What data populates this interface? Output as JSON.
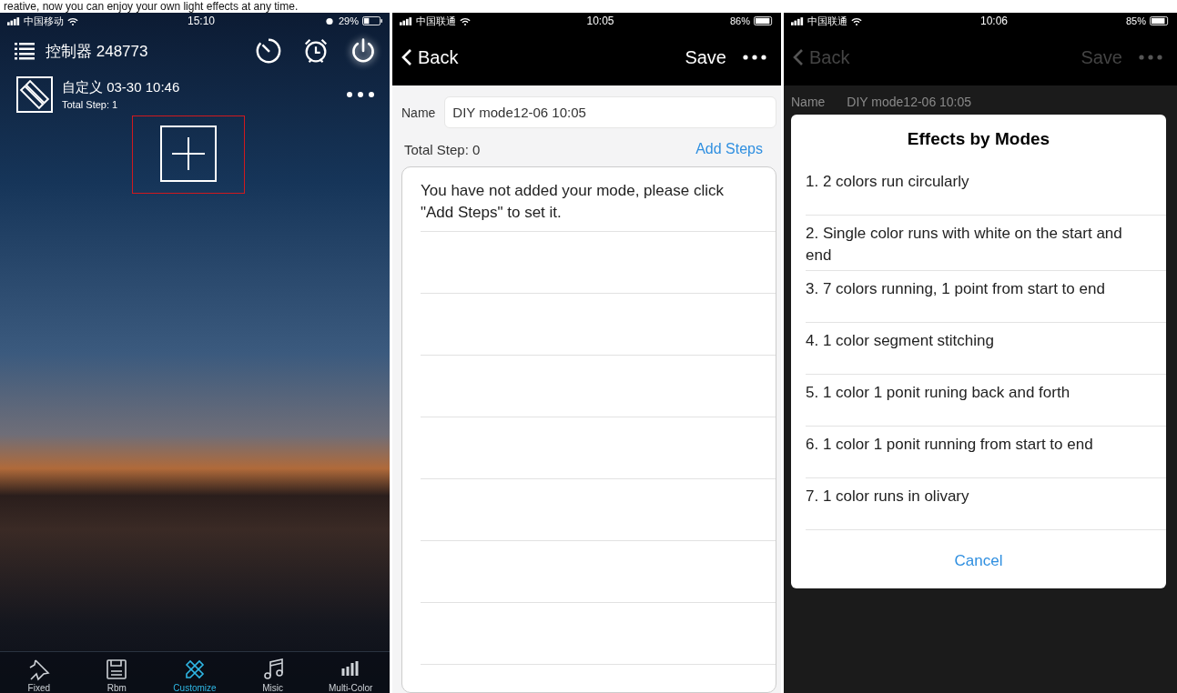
{
  "caption": "reative, now you can enjoy your own light effects at any time.",
  "controller_screen": {
    "status_bar": {
      "carrier": "中国移动",
      "time": "15:10",
      "battery": "29%"
    },
    "title": "控制器 248773",
    "mode": {
      "name": "自定义 03-30 10:46",
      "subtitle": "Total Step: 1"
    },
    "tabs": [
      {
        "label": "Fixed",
        "kind": "pin",
        "selected": false
      },
      {
        "label": "Rbm",
        "kind": "save",
        "selected": false
      },
      {
        "label": "Customize",
        "kind": "tools",
        "selected": true
      },
      {
        "label": "Misic",
        "kind": "music",
        "selected": false
      },
      {
        "label": "Multi-Color",
        "kind": "bars",
        "selected": false
      }
    ]
  },
  "edit_screen": {
    "status_bar": {
      "carrier": "中国联通",
      "time": "10:05",
      "battery": "86%"
    },
    "back": "Back",
    "save": "Save",
    "name_label": "Name",
    "name_value": "DIY mode12-06 10:05",
    "total_steps": "Total Step: 0",
    "add_steps": "Add Steps",
    "message": "You have not added your mode, please click \"Add Steps\" to set it."
  },
  "modes_screen": {
    "status_bar": {
      "carrier": "中国联通",
      "time": "10:06",
      "battery": "85%"
    },
    "back": "Back",
    "save": "Save",
    "name_label": "Name",
    "name_value": "DIY mode12-06 10:05",
    "dialog": {
      "title": "Effects by Modes",
      "options": [
        "1. 2 colors run circularly",
        "2. Single color runs with white on the start and end",
        "3. 7 colors running, 1 point from start to end",
        "4. 1 color segment stitching",
        "5. 1 color 1 ponit runing back and forth",
        "6. 1 color 1 ponit running from start to end",
        "7. 1 color runs in olivary"
      ],
      "cancel": "Cancel"
    }
  }
}
